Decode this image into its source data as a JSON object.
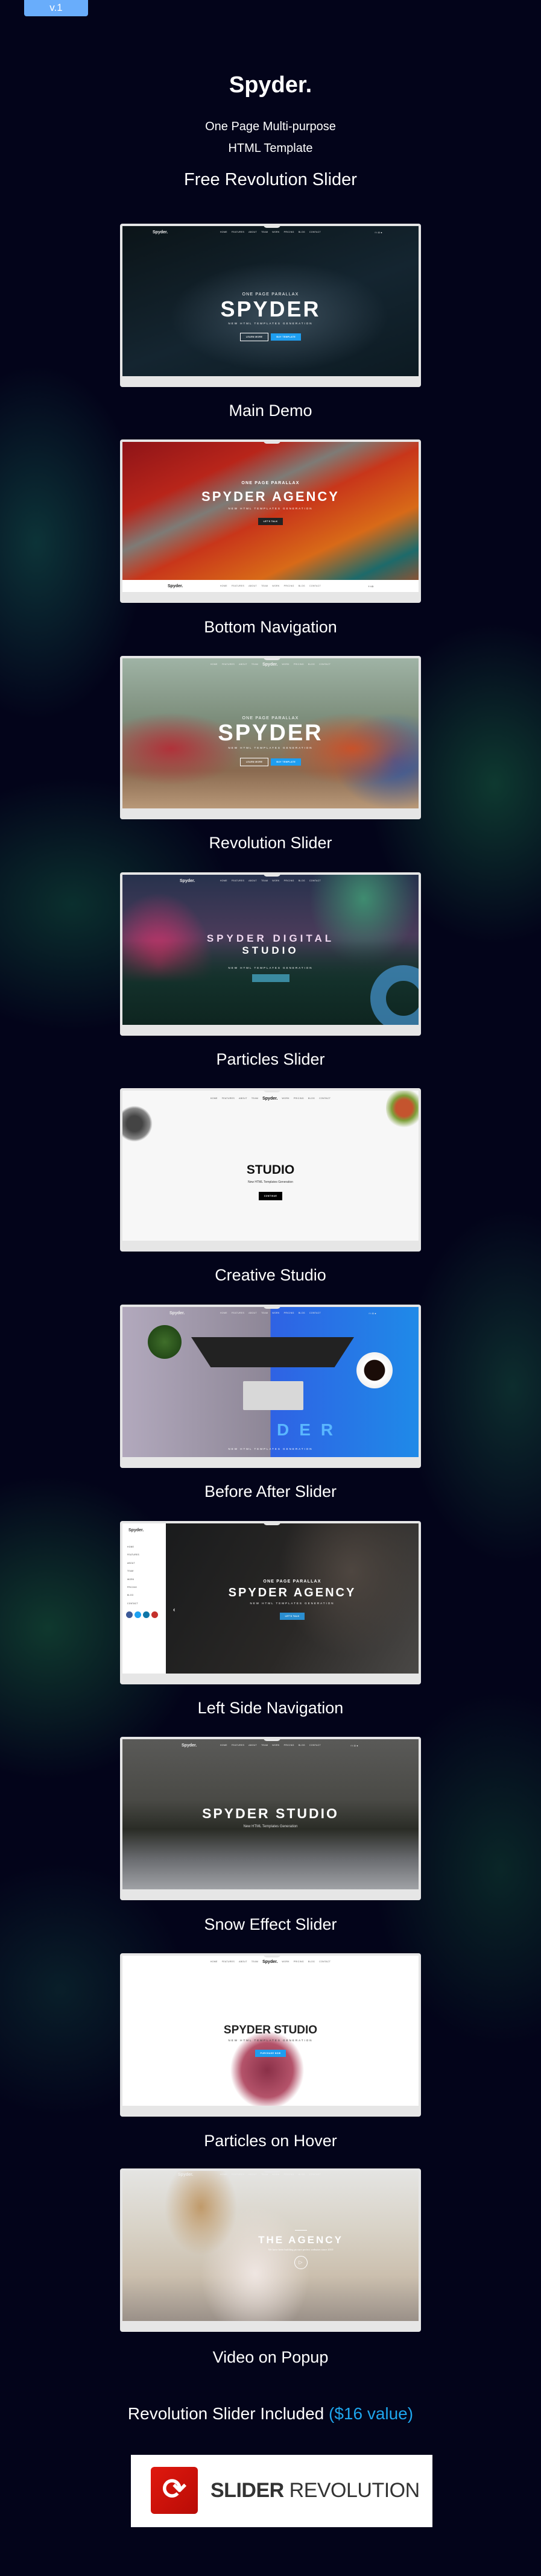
{
  "badge": "v.1",
  "header": {
    "brand": "Spyder.",
    "tagline1": "One Page Multi-purpose",
    "tagline2": "HTML Template",
    "free": "Free Revolution Slider"
  },
  "nav": [
    "HOME",
    "FEATURES",
    "ABOUT",
    "TEAM",
    "WORK",
    "PRICING",
    "BLOG",
    "CONTACT"
  ],
  "demos": [
    {
      "label": "Main Demo",
      "brand": "Spyder.",
      "kicker": "ONE PAGE PARALLAX",
      "title": "SPYDER",
      "subtitle": "NEW HTML TEMPLATES GENERATION",
      "button": "LEARN MORE",
      "button2": "BUY TEMPLATE"
    },
    {
      "label": "Bottom Navigation",
      "brand": "Spyder.",
      "kicker": "ONE PAGE PARALLAX",
      "title": "SPYDER AGENCY",
      "subtitle": "NEW HTML TEMPLATES GENERATION",
      "button": "LET'S TALK"
    },
    {
      "label": "Revolution Slider",
      "brand": "Spyder.",
      "kicker": "ONE PAGE PARALLAX",
      "title": "SPYDER",
      "subtitle": "NEW HTML TEMPLATES GENERATION",
      "button": "LEARN MORE",
      "button2": "BUY TEMPLATE"
    },
    {
      "label": "Particles Slider",
      "brand": "Spyder.",
      "title": "SPYDER DIGITAL",
      "title2": "STUDIO",
      "subtitle": "NEW HTML TEMPLATES GENERATION"
    },
    {
      "label": "Creative Studio",
      "brand": "Spyder.",
      "title": "STUDIO",
      "subtitle": "New HTML Templates Generation",
      "button": "CONTINUE"
    },
    {
      "label": "Before After Slider",
      "brand": "Spyder.",
      "title": "DER",
      "subtitle": "NEW HTML TEMPLATES GENERATION"
    },
    {
      "label": "Left Side Navigation",
      "brand": "Spyder.",
      "kicker": "ONE PAGE PARALLAX",
      "title": "SPYDER AGENCY",
      "subtitle": "NEW HTML TEMPLATES GENERATION",
      "button": "LET'S TALK"
    },
    {
      "label": "Snow Effect Slider",
      "brand": "Spyder.",
      "title": "SPYDER STUDIO",
      "subtitle": "New HTML Templates Generation"
    },
    {
      "label": "Particles on Hover",
      "brand": "Spyder.",
      "title": "SPYDER STUDIO",
      "subtitle": "NEW HTML TEMPLATES GENERATION",
      "button": "PURCHASE NOW"
    },
    {
      "label": "Video on Popup",
      "brand": "Spyder.",
      "title": "THE AGENCY",
      "subtitle": "We have been building picture perfect websites since 2010"
    }
  ],
  "footer": {
    "included": "Revolution Slider Included",
    "value": "($16 value)",
    "logo_bold": "SLIDER",
    "logo_light": "REVOLUTION"
  },
  "colors": {
    "badge": "#69adfb",
    "accent": "#1e9ef0",
    "value": "#1ea5ec",
    "logo_red": "#d0140c",
    "background": "#03041a"
  }
}
